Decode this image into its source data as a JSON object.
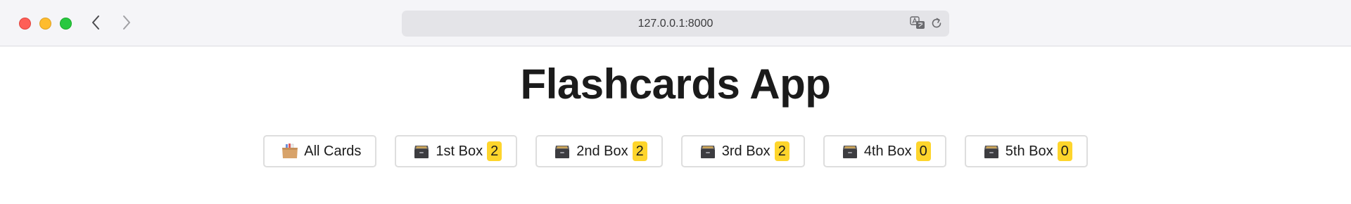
{
  "browser": {
    "url": "127.0.0.1:8000"
  },
  "page": {
    "title": "Flashcards App"
  },
  "boxes": [
    {
      "label": "All Cards",
      "icon": "card-index-icon",
      "count": null
    },
    {
      "label": "1st Box",
      "icon": "file-cabinet-icon",
      "count": "2"
    },
    {
      "label": "2nd Box",
      "icon": "file-cabinet-icon",
      "count": "2"
    },
    {
      "label": "3rd Box",
      "icon": "file-cabinet-icon",
      "count": "2"
    },
    {
      "label": "4th Box",
      "icon": "file-cabinet-icon",
      "count": "0"
    },
    {
      "label": "5th Box",
      "icon": "file-cabinet-icon",
      "count": "0"
    }
  ],
  "colors": {
    "badge": "#fed52c",
    "title": "#1b1b1b"
  }
}
